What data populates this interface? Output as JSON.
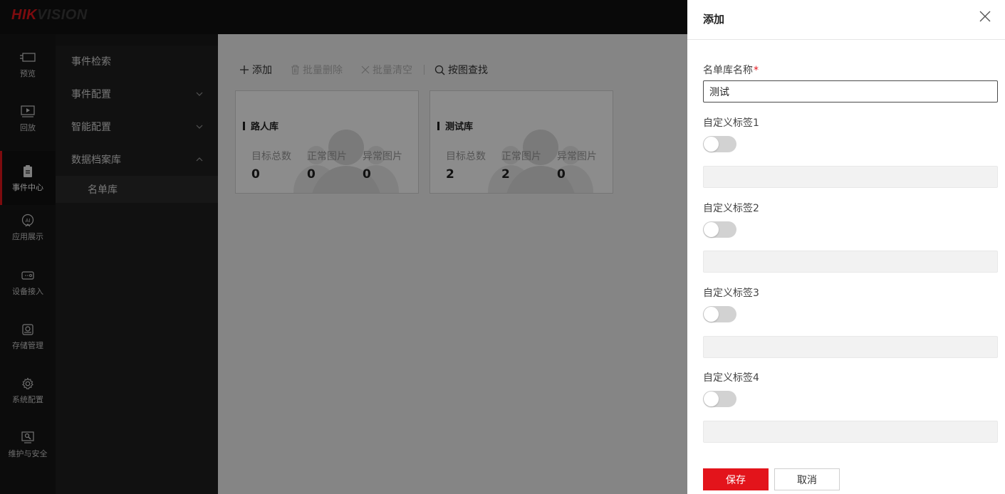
{
  "brand": {
    "hik": "HIK",
    "vision": "VISION"
  },
  "rail": [
    {
      "label": "预览",
      "icon": "preview-icon"
    },
    {
      "label": "回放",
      "icon": "playback-icon"
    },
    {
      "label": "事件中心",
      "icon": "event-center-icon",
      "active": true
    },
    {
      "label": "应用展示",
      "icon": "ai-app-icon"
    },
    {
      "label": "设备接入",
      "icon": "device-access-icon"
    },
    {
      "label": "存储管理",
      "icon": "storage-icon"
    },
    {
      "label": "系统配置",
      "icon": "gear-icon"
    },
    {
      "label": "维护与安全",
      "icon": "maintenance-icon"
    }
  ],
  "submenu": {
    "items": [
      {
        "label": "事件检索"
      },
      {
        "label": "事件配置"
      },
      {
        "label": "智能配置"
      },
      {
        "label": "数据档案库"
      }
    ],
    "sub_items": [
      {
        "label": "名单库",
        "selected": true
      }
    ]
  },
  "toolbar": {
    "add": "添加",
    "batch_delete": "批量删除",
    "batch_clear": "批量清空",
    "search_by_image": "按图查找"
  },
  "cards": [
    {
      "title": "路人库",
      "stats": [
        {
          "label": "目标总数",
          "value": "0"
        },
        {
          "label": "正常图片",
          "value": "0"
        },
        {
          "label": "异常图片",
          "value": "0"
        }
      ]
    },
    {
      "title": "测试库",
      "stats": [
        {
          "label": "目标总数",
          "value": "2"
        },
        {
          "label": "正常图片",
          "value": "2"
        },
        {
          "label": "异常图片",
          "value": "0"
        }
      ]
    }
  ],
  "drawer": {
    "title": "添加",
    "name_label": "名单库名称",
    "required_mark": "*",
    "name_value": "测试",
    "tags": [
      {
        "label": "自定义标签1",
        "enabled": false
      },
      {
        "label": "自定义标签2",
        "enabled": false
      },
      {
        "label": "自定义标签3",
        "enabled": false
      },
      {
        "label": "自定义标签4",
        "enabled": false
      }
    ],
    "save": "保存",
    "cancel": "取消"
  },
  "colors": {
    "accent": "#e3141b",
    "topbar": "#121212",
    "rail": "#171717",
    "submenu": "#1f1f1f"
  }
}
